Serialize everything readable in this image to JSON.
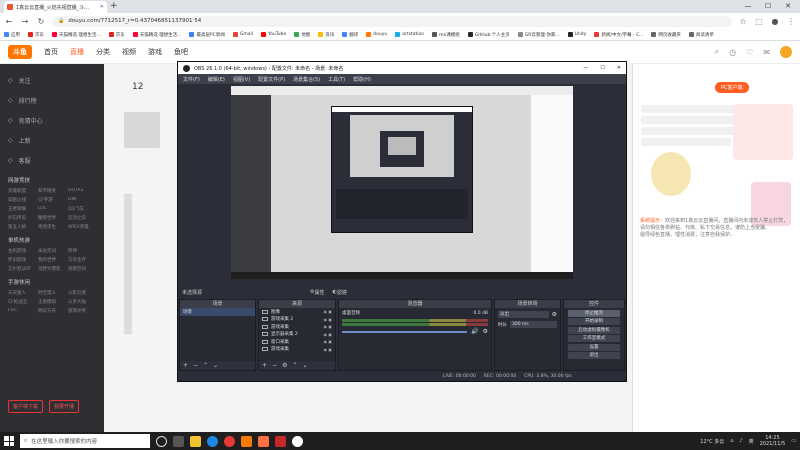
{
  "browser": {
    "tab_title": "1真云云直播_火焰先视直播_斗...",
    "url": "douyu.com/7712517_r=0.437046851137901 54",
    "bookmarks": [
      "应用",
      "京东",
      "天猫精选·理想生活...",
      "京东",
      "天猫精选·理想生活...",
      "最高层PC新闻",
      "Gmail",
      "YouTube",
      "地图",
      "资讯",
      "翻译",
      "douyu",
      "artstation",
      "mo课模组",
      "GitHub·个人主页",
      "GR云管理·你家...",
      "Unity",
      "新闻/中文/字幕 - C...",
      "网页收藏夹",
      "阅读清单"
    ],
    "controls": {
      "min": "—",
      "max": "☐",
      "close": "✕"
    }
  },
  "douyu": {
    "logo": "斗鱼",
    "nav": [
      "首页",
      "直播",
      "分类",
      "视频",
      "游戏",
      "鱼吧"
    ],
    "sidebar": {
      "items": [
        "关注",
        "排行榜",
        "竞猜中心",
        "上新",
        "客服"
      ],
      "groups": [
        {
          "title": "网游竞技",
          "items": [
            "英雄联盟",
            "和平精英",
            "DOTA2",
            "穿越火线",
            "CF手游",
            "DNF",
            "王者荣耀",
            "LOL",
            "QQ飞车",
            "炉石传说",
            "魔兽世界",
            "云顶之弈",
            "第五人格",
            "绝地求生",
            "APEX英雄"
          ]
        },
        {
          "title": "单机热游",
          "items": [
            "主机游戏",
            "永劫无间",
            "原神",
            "怀旧游戏",
            "我的世界",
            "方舟生存",
            "艾尔登法环",
            "荒野大镖客",
            "杀戮空间"
          ]
        },
        {
          "title": "手游休闲",
          "items": [
            "天天狼人",
            "时空猎人",
            "火影忍者",
            "CF枪战王",
            "王者模拟",
            "斗罗大陆",
            "FGC",
            "明日方舟",
            "部落冲突"
          ]
        }
      ],
      "btn_download": "客户端下载",
      "btn_live": "我要开播"
    },
    "room_count": "12",
    "right": {
      "pc_btn": "PC客户端"
    },
    "chat": [
      {
        "user": "系统提示：",
        "text": "欢迎来到1真云云直播间，直播间内未成年人禁止打赏，请勿相信各类刷钻、代练、私下交易信息，谨防上当受骗。"
      },
      {
        "user": "",
        "text": "倡导绿色直播，理性消费，注意自我保护。"
      }
    ]
  },
  "obs": {
    "title": "OBS 26.1.0 (64-bit, windows) - 配置文件: 未命名 - 场景: 未命名",
    "menu": [
      "文件(F)",
      "编辑(E)",
      "视图(V)",
      "配置文件(P)",
      "场景集合(S)",
      "工具(T)",
      "帮助(H)"
    ],
    "status_label": "未选择源",
    "properties_btn": "属性",
    "filters_btn": "滤镜",
    "docks": {
      "scenes": "场景",
      "sources": "来源",
      "mixer": "混音器",
      "transitions": "场景转场",
      "controls": "控件"
    },
    "scenes": [
      "场景"
    ],
    "sources": [
      "图像",
      "游戏采集 2",
      "游戏采集",
      "显示器采集 2",
      "窗口采集",
      "游戏采集"
    ],
    "mixer": {
      "track": "桌面音频",
      "level": "0.0 dB"
    },
    "transitions": {
      "type": "淡出",
      "duration_label": "时长",
      "duration": "300 ms"
    },
    "controls": [
      "停止推流",
      "开始录制",
      "启动虚拟摄像机",
      "工作室模式",
      "设置",
      "退出"
    ],
    "stats": {
      "live": "LIVE: 00:00:00",
      "rec": "REC: 00:00:00",
      "cpu": "CPU: 3.8%, 30.00 fps"
    }
  },
  "taskbar": {
    "search_placeholder": "在这里输入你要搜索的内容",
    "weather": "12°C 多云",
    "lang": "英",
    "time": "14:25",
    "date": "2021/11/5"
  }
}
